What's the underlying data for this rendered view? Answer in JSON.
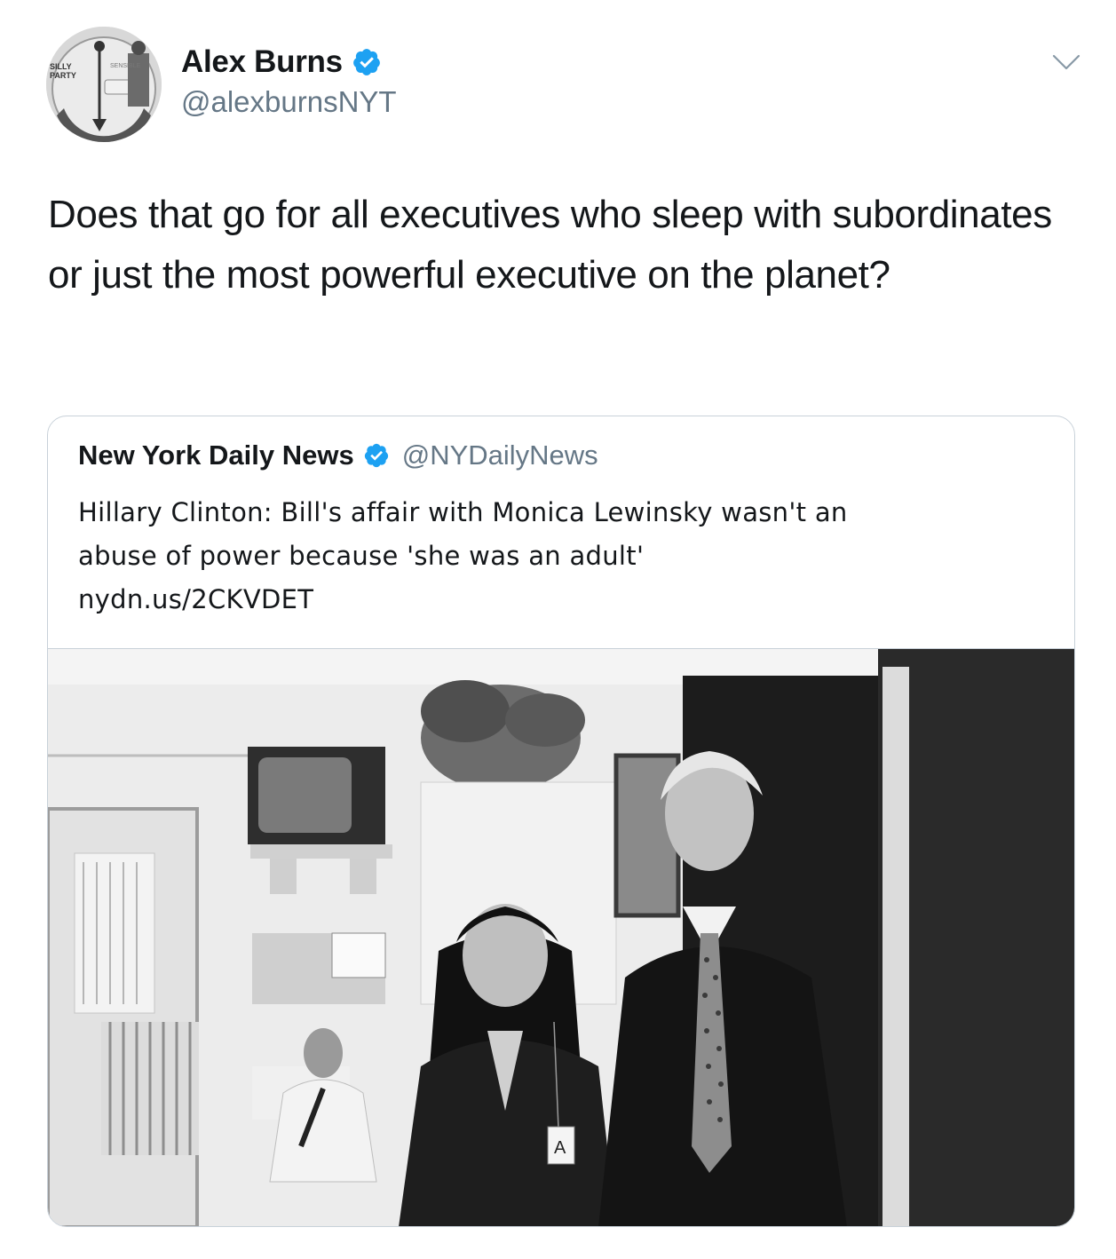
{
  "tweet": {
    "author": {
      "display_name": "Alex Burns",
      "handle": "@alexburnsNYT",
      "verified": true,
      "avatar_icon": "dial-photo-avatar",
      "avatar_text": [
        "SILLY",
        "PARTY",
        "SENSIBLE"
      ]
    },
    "text": "Does that go for all executives who sleep with subordinates or just the most powerful executive on the planet?",
    "menu_icon": "chevron-down-icon"
  },
  "quoted_tweet": {
    "author": {
      "display_name": "New York Daily News",
      "handle": "@NYDailyNews",
      "verified": true
    },
    "text_line1": "Hillary Clinton: Bill's affair with Monica Lewinsky wasn't an",
    "text_line2": "abuse of power because 'she was an adult'",
    "link": "nydn.us/2CKVDET",
    "photo": {
      "description_icon": "black-and-white-photo",
      "badge_letter": "A"
    }
  },
  "colors": {
    "text_primary": "#14171a",
    "text_secondary": "#657786",
    "verified_blue": "#1da1f2",
    "border": "#c8d1d9"
  }
}
